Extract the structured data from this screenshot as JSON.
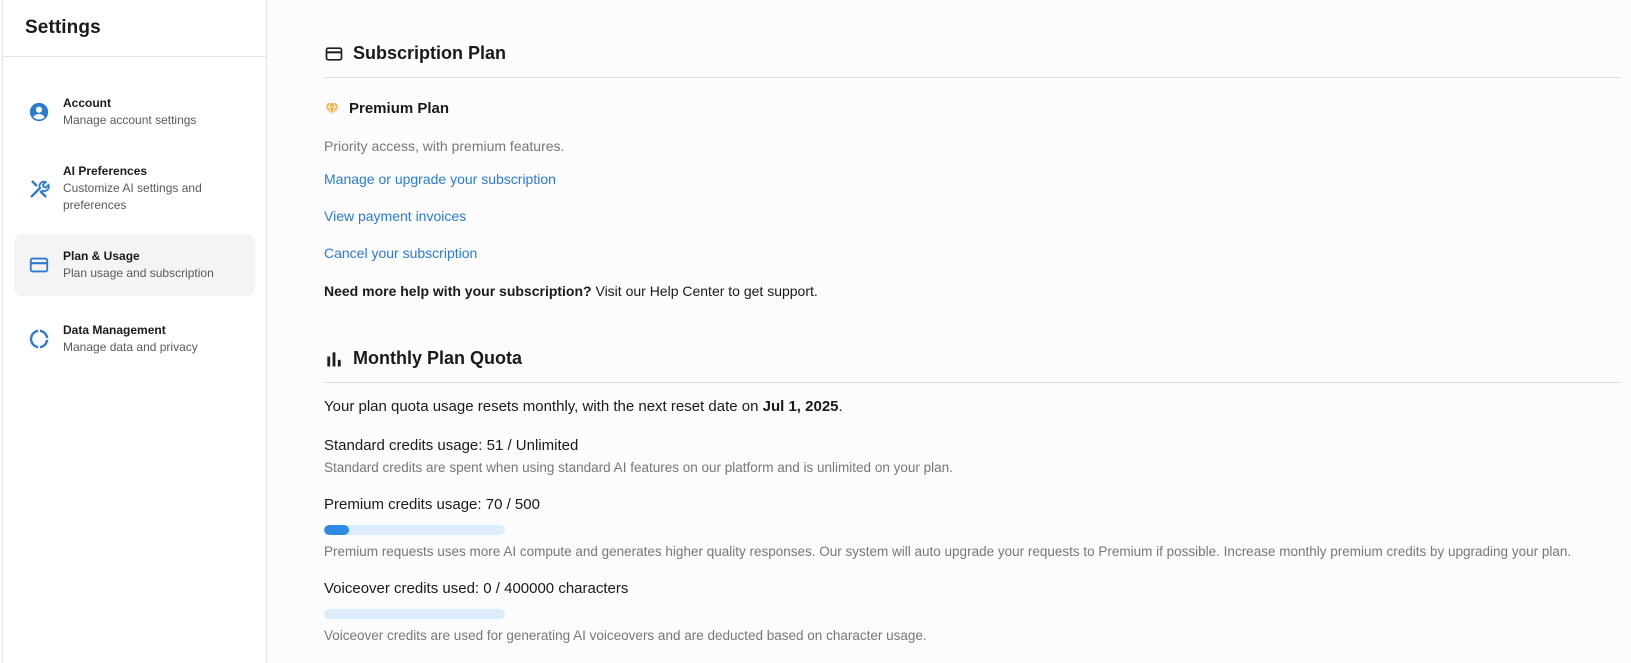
{
  "sidebar": {
    "title": "Settings",
    "items": [
      {
        "label": "Account",
        "desc": "Manage account settings",
        "icon": "account-circle-icon"
      },
      {
        "label": "AI Preferences",
        "desc": "Customize AI settings and preferences",
        "icon": "tools-icon"
      },
      {
        "label": "Plan & Usage",
        "desc": "Plan usage and subscription",
        "icon": "credit-card-icon",
        "active": true
      },
      {
        "label": "Data Management",
        "desc": "Manage data and privacy",
        "icon": "donut-icon"
      }
    ]
  },
  "subscription": {
    "title": "Subscription Plan",
    "plan_name": "Premium Plan",
    "plan_desc": "Priority access, with premium features.",
    "links": {
      "manage": "Manage or upgrade your subscription",
      "invoices": "View payment invoices",
      "cancel": "Cancel your subscription"
    },
    "help_bold": "Need more help with your subscription?",
    "help_text": " Visit our Help Center to get support."
  },
  "quota": {
    "title": "Monthly Plan Quota",
    "reset_text": "Your plan quota usage resets monthly, with the next reset date on ",
    "reset_date": "Jul 1, 2025",
    "reset_suffix": ".",
    "standard": {
      "label": "Standard credits usage: 51 / Unlimited",
      "desc": "Standard credits are spent when using standard AI features on our platform and is unlimited on your plan."
    },
    "premium": {
      "label": "Premium credits usage: 70 / 500",
      "used": 70,
      "total": 500,
      "desc": "Premium requests uses more AI compute and generates higher quality responses. Our system will auto upgrade your requests to Premium if possible. Increase monthly premium credits by upgrading your plan."
    },
    "voiceover": {
      "label": "Voiceover credits used: 0 / 400000 characters",
      "used": 0,
      "total": 400000,
      "desc": "Voiceover credits are used for generating AI voiceovers and are deducted based on character usage."
    }
  },
  "colors": {
    "accent": "#2b7bd0",
    "bar_fill": "#2f8ae6",
    "bar_track": "#ddecfb",
    "gem": "#e8b34a"
  }
}
